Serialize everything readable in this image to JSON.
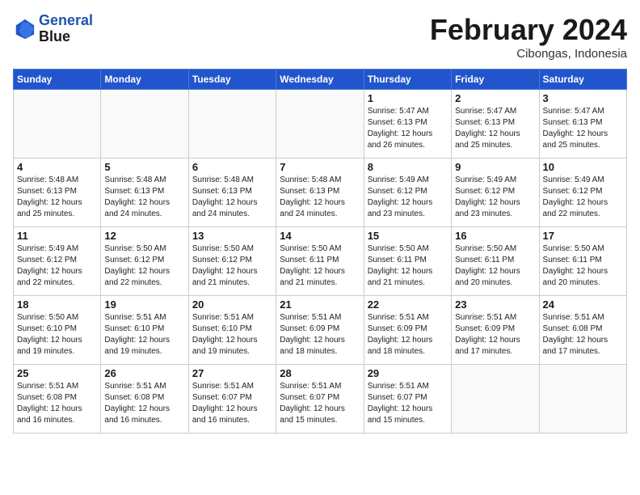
{
  "header": {
    "logo_line1": "General",
    "logo_line2": "Blue",
    "month_year": "February 2024",
    "location": "Cibongas, Indonesia"
  },
  "weekdays": [
    "Sunday",
    "Monday",
    "Tuesday",
    "Wednesday",
    "Thursday",
    "Friday",
    "Saturday"
  ],
  "weeks": [
    [
      {
        "day": "",
        "info": ""
      },
      {
        "day": "",
        "info": ""
      },
      {
        "day": "",
        "info": ""
      },
      {
        "day": "",
        "info": ""
      },
      {
        "day": "1",
        "info": "Sunrise: 5:47 AM\nSunset: 6:13 PM\nDaylight: 12 hours\nand 26 minutes."
      },
      {
        "day": "2",
        "info": "Sunrise: 5:47 AM\nSunset: 6:13 PM\nDaylight: 12 hours\nand 25 minutes."
      },
      {
        "day": "3",
        "info": "Sunrise: 5:47 AM\nSunset: 6:13 PM\nDaylight: 12 hours\nand 25 minutes."
      }
    ],
    [
      {
        "day": "4",
        "info": "Sunrise: 5:48 AM\nSunset: 6:13 PM\nDaylight: 12 hours\nand 25 minutes."
      },
      {
        "day": "5",
        "info": "Sunrise: 5:48 AM\nSunset: 6:13 PM\nDaylight: 12 hours\nand 24 minutes."
      },
      {
        "day": "6",
        "info": "Sunrise: 5:48 AM\nSunset: 6:13 PM\nDaylight: 12 hours\nand 24 minutes."
      },
      {
        "day": "7",
        "info": "Sunrise: 5:48 AM\nSunset: 6:13 PM\nDaylight: 12 hours\nand 24 minutes."
      },
      {
        "day": "8",
        "info": "Sunrise: 5:49 AM\nSunset: 6:12 PM\nDaylight: 12 hours\nand 23 minutes."
      },
      {
        "day": "9",
        "info": "Sunrise: 5:49 AM\nSunset: 6:12 PM\nDaylight: 12 hours\nand 23 minutes."
      },
      {
        "day": "10",
        "info": "Sunrise: 5:49 AM\nSunset: 6:12 PM\nDaylight: 12 hours\nand 22 minutes."
      }
    ],
    [
      {
        "day": "11",
        "info": "Sunrise: 5:49 AM\nSunset: 6:12 PM\nDaylight: 12 hours\nand 22 minutes."
      },
      {
        "day": "12",
        "info": "Sunrise: 5:50 AM\nSunset: 6:12 PM\nDaylight: 12 hours\nand 22 minutes."
      },
      {
        "day": "13",
        "info": "Sunrise: 5:50 AM\nSunset: 6:12 PM\nDaylight: 12 hours\nand 21 minutes."
      },
      {
        "day": "14",
        "info": "Sunrise: 5:50 AM\nSunset: 6:11 PM\nDaylight: 12 hours\nand 21 minutes."
      },
      {
        "day": "15",
        "info": "Sunrise: 5:50 AM\nSunset: 6:11 PM\nDaylight: 12 hours\nand 21 minutes."
      },
      {
        "day": "16",
        "info": "Sunrise: 5:50 AM\nSunset: 6:11 PM\nDaylight: 12 hours\nand 20 minutes."
      },
      {
        "day": "17",
        "info": "Sunrise: 5:50 AM\nSunset: 6:11 PM\nDaylight: 12 hours\nand 20 minutes."
      }
    ],
    [
      {
        "day": "18",
        "info": "Sunrise: 5:50 AM\nSunset: 6:10 PM\nDaylight: 12 hours\nand 19 minutes."
      },
      {
        "day": "19",
        "info": "Sunrise: 5:51 AM\nSunset: 6:10 PM\nDaylight: 12 hours\nand 19 minutes."
      },
      {
        "day": "20",
        "info": "Sunrise: 5:51 AM\nSunset: 6:10 PM\nDaylight: 12 hours\nand 19 minutes."
      },
      {
        "day": "21",
        "info": "Sunrise: 5:51 AM\nSunset: 6:09 PM\nDaylight: 12 hours\nand 18 minutes."
      },
      {
        "day": "22",
        "info": "Sunrise: 5:51 AM\nSunset: 6:09 PM\nDaylight: 12 hours\nand 18 minutes."
      },
      {
        "day": "23",
        "info": "Sunrise: 5:51 AM\nSunset: 6:09 PM\nDaylight: 12 hours\nand 17 minutes."
      },
      {
        "day": "24",
        "info": "Sunrise: 5:51 AM\nSunset: 6:08 PM\nDaylight: 12 hours\nand 17 minutes."
      }
    ],
    [
      {
        "day": "25",
        "info": "Sunrise: 5:51 AM\nSunset: 6:08 PM\nDaylight: 12 hours\nand 16 minutes."
      },
      {
        "day": "26",
        "info": "Sunrise: 5:51 AM\nSunset: 6:08 PM\nDaylight: 12 hours\nand 16 minutes."
      },
      {
        "day": "27",
        "info": "Sunrise: 5:51 AM\nSunset: 6:07 PM\nDaylight: 12 hours\nand 16 minutes."
      },
      {
        "day": "28",
        "info": "Sunrise: 5:51 AM\nSunset: 6:07 PM\nDaylight: 12 hours\nand 15 minutes."
      },
      {
        "day": "29",
        "info": "Sunrise: 5:51 AM\nSunset: 6:07 PM\nDaylight: 12 hours\nand 15 minutes."
      },
      {
        "day": "",
        "info": ""
      },
      {
        "day": "",
        "info": ""
      }
    ]
  ]
}
